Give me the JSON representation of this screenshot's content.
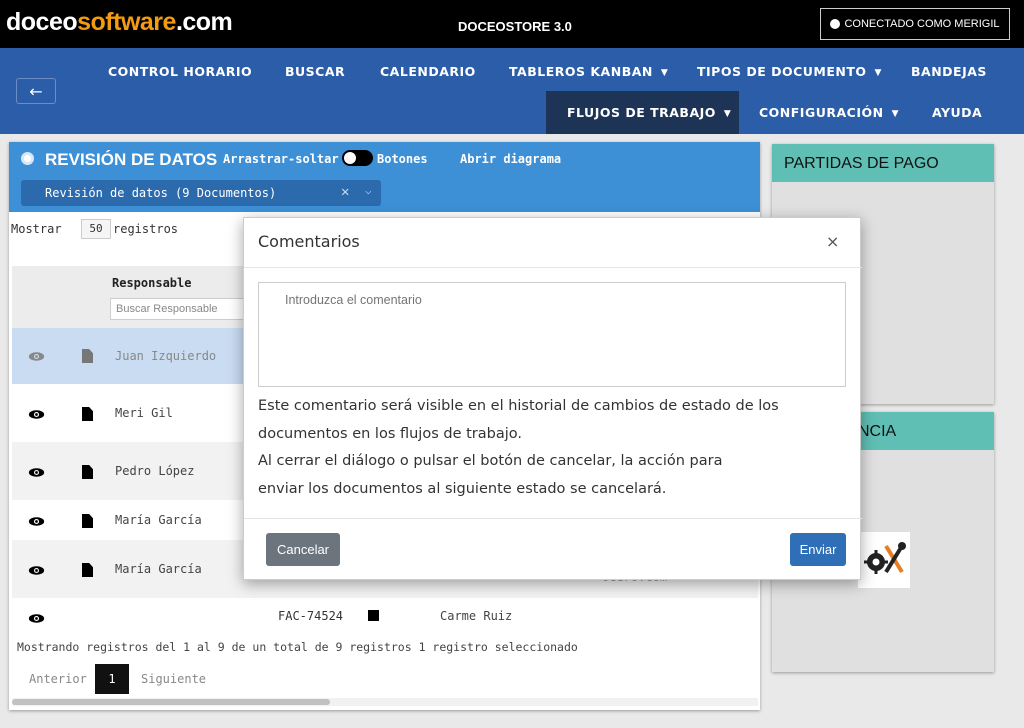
{
  "header": {
    "logo_part1": "doceo",
    "logo_part2": "software",
    "logo_part3": ".com",
    "app_title": "DOCEOSTORE 3.0",
    "connected_label": "CONECTADO COMO MERIGIL"
  },
  "nav": {
    "items": [
      {
        "label": "CONTROL HORARIO"
      },
      {
        "label": "BUSCAR"
      },
      {
        "label": "CALENDARIO"
      },
      {
        "label": "TABLEROS KANBAN"
      },
      {
        "label": "TIPOS DE DOCUMENTO"
      },
      {
        "label": "BANDEJAS"
      },
      {
        "label": "FLUJOS DE TRABAJO"
      },
      {
        "label": "CONFIGURACIÓN"
      },
      {
        "label": "AYUDA"
      }
    ],
    "back_arrow": "←"
  },
  "left_panel": {
    "title": "REVISIÓN DE DATOS",
    "drag_drop_label": "Arrastrar-soltar",
    "buttons_label": "Botones",
    "open_diagram_label": "Abrir diagrama",
    "selected_queue": "Revisión de datos (9 Documentos)",
    "show_label": "Mostrar",
    "per_page": "50",
    "records_label": "registros",
    "column_responsable": "Responsable",
    "search_responsable_placeholder": "Buscar Responsable",
    "rows": [
      {
        "name": "Juan Izquierdo"
      },
      {
        "name": "Meri Gil"
      },
      {
        "name": "Pedro López"
      },
      {
        "name": "María García"
      },
      {
        "name": "María García"
      }
    ],
    "last_row": {
      "invoice": "FAC-74524",
      "responsable": "Carme Ruiz",
      "email_fragment": "ocero.com"
    },
    "footer_info": "Mostrando registros del 1 al 9 de un total de 9 registros   1 registro seleccionado",
    "pager": {
      "previous": "Anterior",
      "page": "1",
      "next": "Siguiente"
    }
  },
  "right_panels": {
    "payments_title": "PARTIDAS DE PAGO",
    "second_title_fragment": "NCIA"
  },
  "modal": {
    "title": "Comentarios",
    "close": "×",
    "placeholder": "Introduzca el comentario",
    "line1": "Este comentario será visible en el historial de cambios de estado de los",
    "line2": "documentos en los flujos de trabajo.",
    "line3": "Al cerrar el diálogo o pulsar el botón de cancelar, la acción para",
    "line4": "enviar los documentos al siguiente estado se cancelará.",
    "cancel_label": "Cancelar",
    "send_label": "Enviar"
  },
  "colors": {
    "nav_blue": "#2c5da8",
    "panel_blue": "#3d8fd6",
    "teal": "#5fbfb4",
    "logo_accent": "#f39c12"
  }
}
